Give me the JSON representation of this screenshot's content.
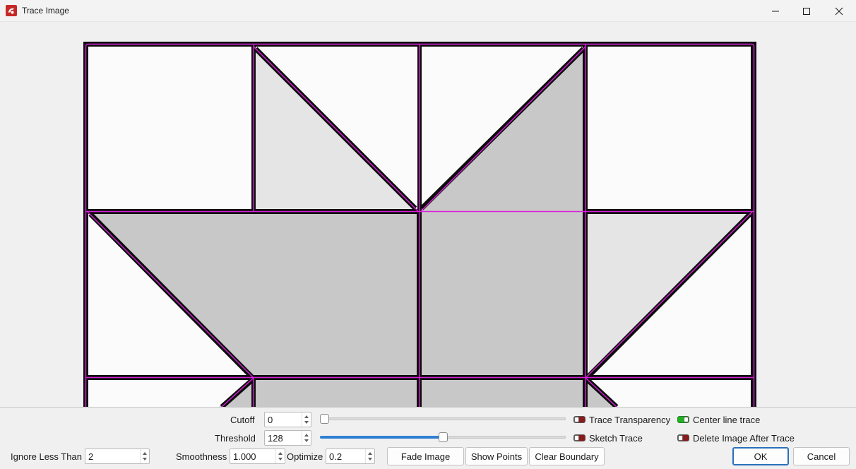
{
  "window": {
    "title": "Trace Image",
    "controls": [
      "minimize-icon",
      "maximize-icon",
      "close-icon"
    ]
  },
  "colors": {
    "outline": "#0d0d0d",
    "trace_line": "#d91ed9",
    "fill_white": "#fbfbfb",
    "fill_light": "#e5e5e5",
    "fill_mid": "#c8c8c8",
    "slider_fill": "#2f7fd3",
    "toggle_off": "#8b1a1a",
    "toggle_on": "#1db41d"
  },
  "controls": {
    "cutoff": {
      "label": "Cutoff",
      "value": "0",
      "slider_fraction": 0.0
    },
    "threshold": {
      "label": "Threshold",
      "value": "128",
      "slider_fraction": 0.5
    },
    "ignore_less_than": {
      "label": "Ignore Less Than",
      "value": "2"
    },
    "smoothness": {
      "label": "Smoothness",
      "value": "1.000"
    },
    "optimize": {
      "label": "Optimize",
      "value": "0.2"
    }
  },
  "toggles": {
    "trace_transparency": {
      "label": "Trace Transparency",
      "on": false
    },
    "center_line_trace": {
      "label": "Center line trace",
      "on": true
    },
    "sketch_trace": {
      "label": "Sketch Trace",
      "on": false
    },
    "delete_image_after_trace": {
      "label": "Delete Image After Trace",
      "on": false
    }
  },
  "buttons": {
    "fade_image": "Fade Image",
    "show_points": "Show Points",
    "clear_boundary": "Clear Boundary",
    "ok": "OK",
    "cancel": "Cancel"
  }
}
